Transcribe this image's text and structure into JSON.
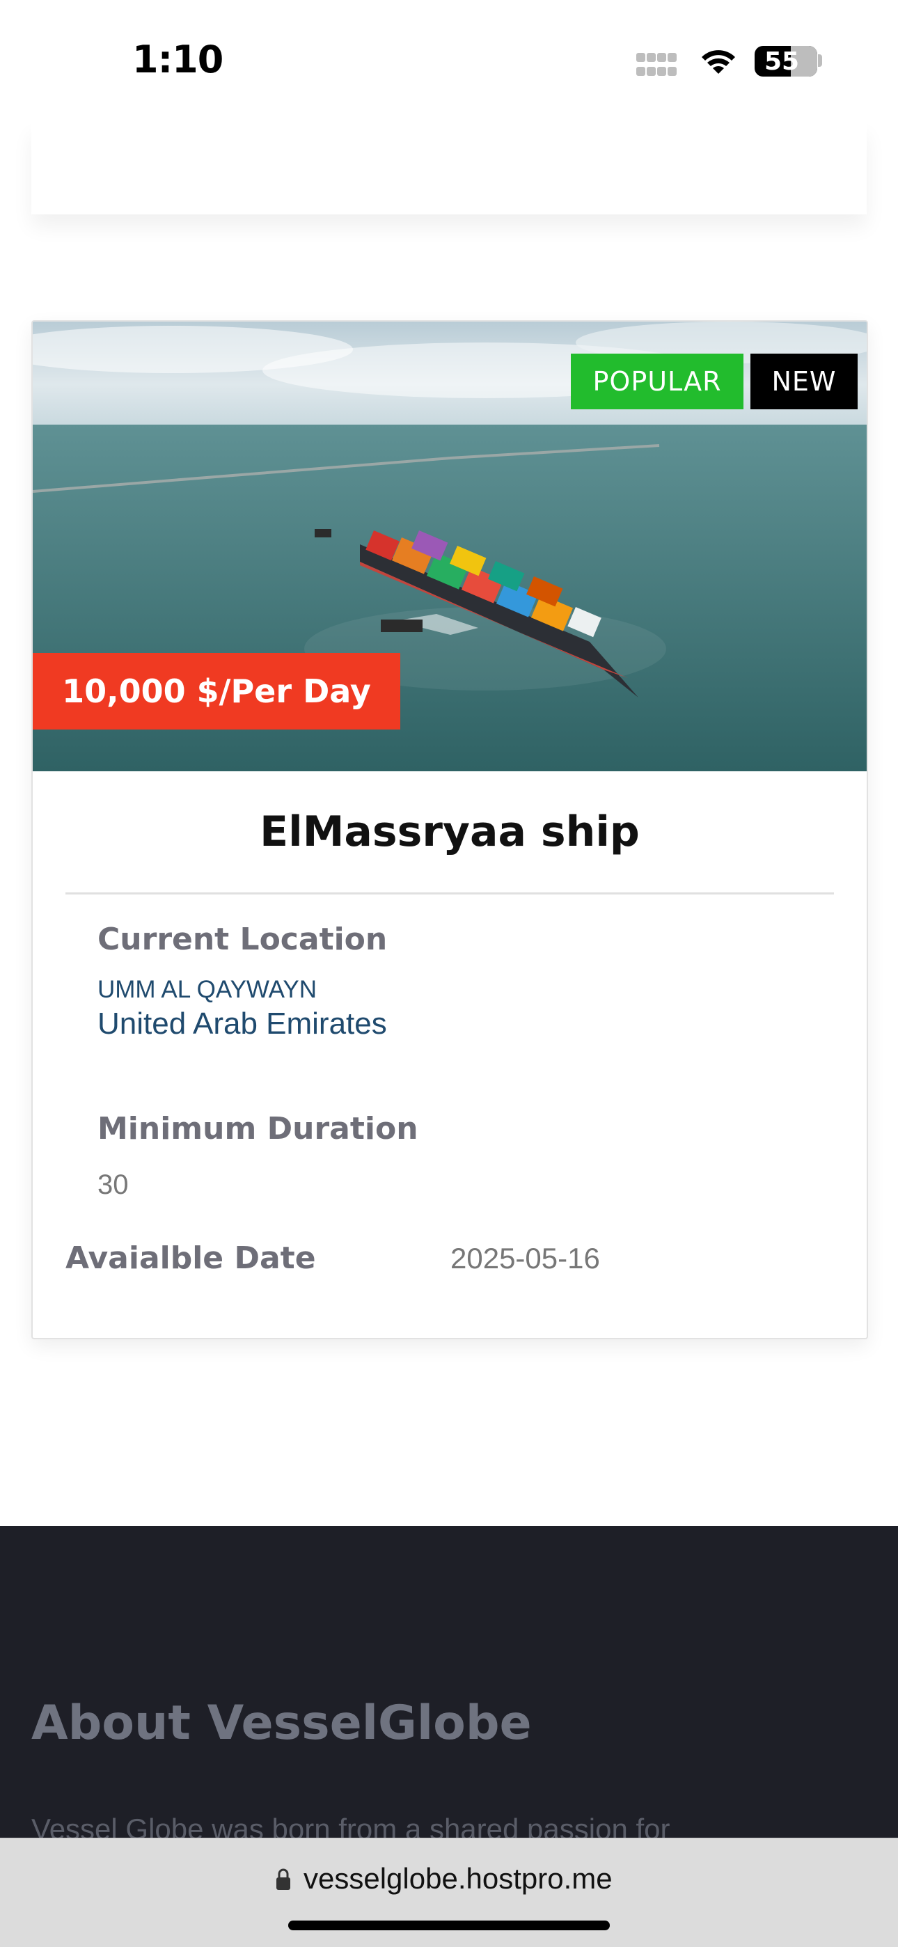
{
  "status_bar": {
    "time": "1:10",
    "battery": "55"
  },
  "listing": {
    "badges": {
      "popular": "POPULAR",
      "new": "NEW"
    },
    "price": "10,000 $/Per Day",
    "name": "ElMassryaa ship",
    "current_location": {
      "label": "Current Location",
      "city": "UMM AL QAYWAYN",
      "country": "United Arab Emirates"
    },
    "minimum_duration": {
      "label": "Minimum Duration",
      "value": "30"
    },
    "available_date": {
      "label": "Avaialble Date",
      "value": "2025-05-16"
    }
  },
  "footer": {
    "about_title": "About VesselGlobe",
    "about_text": "Vessel Globe was born from a shared passion for"
  },
  "browser": {
    "url": "vesselglobe.hostpro.me"
  },
  "colors": {
    "popular": "#22bc2d",
    "new": "#000000",
    "price": "#f03a22",
    "footer_bg": "#1e1f27",
    "location_text": "#1f4a6e"
  }
}
